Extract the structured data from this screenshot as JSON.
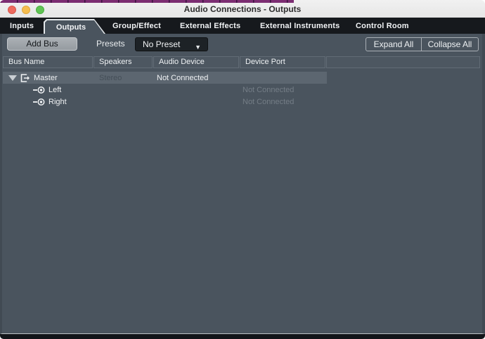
{
  "window": {
    "title": "Audio Connections - Outputs"
  },
  "traffic_lights": {
    "close": "#ed6a5e",
    "minimize": "#f5bd4f",
    "zoom": "#61c354"
  },
  "tabs": [
    {
      "label": "Inputs",
      "active": false
    },
    {
      "label": "Outputs",
      "active": true
    },
    {
      "label": "Group/Effect",
      "active": false
    },
    {
      "label": "External Effects",
      "active": false
    },
    {
      "label": "External Instruments",
      "active": false
    },
    {
      "label": "Control Room",
      "active": false
    }
  ],
  "toolbar": {
    "add_bus_label": "Add Bus",
    "presets_label": "Presets",
    "preset_value": "No Preset",
    "dropdown_arrow": "▼",
    "expand_all_label": "Expand All",
    "collapse_all_label": "Collapse All"
  },
  "table": {
    "columns": [
      "Bus Name",
      "Speakers",
      "Audio Device",
      "Device Port",
      ""
    ],
    "rows": [
      {
        "name": "Master",
        "speakers": "Stereo",
        "audio_device": "Not Connected",
        "device_port": "",
        "level": 0,
        "expanded": true,
        "selected": true
      },
      {
        "name": "Left",
        "speakers": "",
        "audio_device": "",
        "device_port": "Not Connected",
        "level": 1,
        "selected": false
      },
      {
        "name": "Right",
        "speakers": "",
        "audio_device": "",
        "device_port": "Not Connected",
        "level": 1,
        "selected": false
      }
    ]
  },
  "colors": {
    "content_bg": "#4a545e",
    "tabbar_bg": "#16191d",
    "selected_row": "#5c6670",
    "header_cell": "#4d5761",
    "dropdown_bg": "#1d2226",
    "accent_strip": "#7c2d72",
    "bottom_strip": "#121519"
  }
}
